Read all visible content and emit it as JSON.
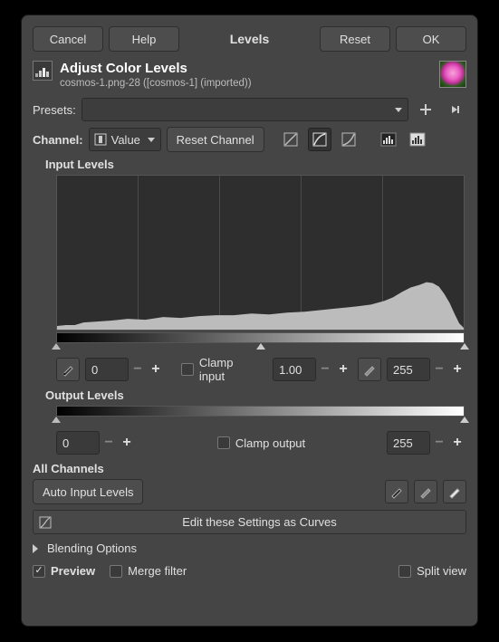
{
  "titlebar": {
    "cancel": "Cancel",
    "help": "Help",
    "title": "Levels",
    "reset": "Reset",
    "ok": "OK"
  },
  "header": {
    "title": "Adjust Color Levels",
    "subtitle": "cosmos-1.png-28 ([cosmos-1] (imported))"
  },
  "presets": {
    "label": "Presets:",
    "value": ""
  },
  "channel": {
    "label": "Channel:",
    "value": "Value",
    "reset": "Reset Channel"
  },
  "input_levels": {
    "label": "Input Levels",
    "low": "0",
    "gamma": "1.00",
    "high": "255",
    "clamp": "Clamp input"
  },
  "output_levels": {
    "label": "Output Levels",
    "low": "0",
    "high": "255",
    "clamp": "Clamp output"
  },
  "all_channels": {
    "label": "All Channels",
    "auto": "Auto Input Levels"
  },
  "edit_curves": "Edit these Settings as Curves",
  "blending": "Blending Options",
  "footer": {
    "preview": "Preview",
    "merge": "Merge filter",
    "split": "Split view"
  },
  "icons": {
    "value_channel": "value-channel-icon",
    "linear": "linear-histogram-icon",
    "log": "log-histogram-icon",
    "perceptual": "perceptual-histogram-icon",
    "lum_a": "luminance-a-icon",
    "lum_b": "luminance-b-icon",
    "picker_low": "black-point-picker-icon",
    "picker_mid": "gray-point-picker-icon",
    "picker_high": "white-point-picker-icon",
    "add_preset": "add-preset-icon",
    "preset_menu": "preset-menu-icon",
    "curves": "curves-icon"
  }
}
